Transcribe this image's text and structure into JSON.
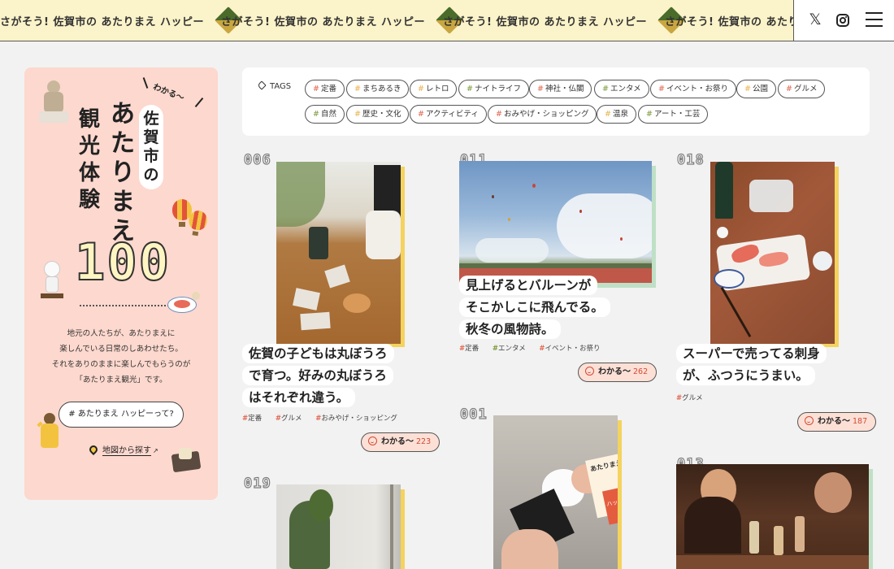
{
  "header": {
    "marquee_text": "さがそう! 佐賀市の あたりまえ ハッピー",
    "icons": [
      "x-icon",
      "instagram-icon",
      "menu-icon"
    ]
  },
  "sidebar": {
    "tagline": "わかる〜",
    "title_small": "佐賀市の",
    "title_main": "あたりまえ",
    "title_sub": "観光体験",
    "count": "100",
    "description": [
      "地元の人たちが、あたりまえに",
      "楽しんでいる日常のしあわせたち。",
      "それをありのままに楽しんでもらうのが",
      "「あたりまえ観光」です。"
    ],
    "happy_button": "# あたりまえ ハッピーって?",
    "map_link": "地図から探す",
    "map_link_arrow": "↗"
  },
  "tags": {
    "title": "TAGS",
    "items": [
      {
        "label": "定番",
        "hash_color": "#e0664f"
      },
      {
        "label": "まちあるき",
        "hash_color": "#e9b44c"
      },
      {
        "label": "レトロ",
        "hash_color": "#e9b44c"
      },
      {
        "label": "ナイトライフ",
        "hash_color": "#7a9a3a"
      },
      {
        "label": "神社・仏閣",
        "hash_color": "#e0664f"
      },
      {
        "label": "エンタメ",
        "hash_color": "#7a9a3a"
      },
      {
        "label": "イベント・お祭り",
        "hash_color": "#e0664f"
      },
      {
        "label": "公園",
        "hash_color": "#e9b44c"
      },
      {
        "label": "グルメ",
        "hash_color": "#e0664f"
      },
      {
        "label": "自然",
        "hash_color": "#7a9a3a"
      },
      {
        "label": "歴史・文化",
        "hash_color": "#e9b44c"
      },
      {
        "label": "アクティビティ",
        "hash_color": "#e0664f"
      },
      {
        "label": "おみやげ・ショッピング",
        "hash_color": "#e0664f"
      },
      {
        "label": "温泉",
        "hash_color": "#e9b44c"
      },
      {
        "label": "アート・工芸",
        "hash_color": "#7a9a3a"
      }
    ]
  },
  "cards": [
    {
      "number": "006",
      "caption": [
        "佐賀の子どもは丸ぼうろ",
        "で育つ。好みの丸ぼうろ",
        "はそれぞれ違う。"
      ],
      "tags": [
        "定番",
        "グルメ",
        "おみやげ・ショッピング"
      ],
      "wakaru_label": "わかる〜",
      "count": "223",
      "accent_color": "#f4d35e"
    },
    {
      "number": "011",
      "caption": [
        "見上げるとバルーンが",
        "そこかしこに飛んでる。",
        "秋冬の風物詩。"
      ],
      "tags": [
        "定番",
        "エンタメ",
        "イベント・お祭り"
      ],
      "wakaru_label": "わかる〜",
      "count": "262",
      "accent_color": "#bfe0c6"
    },
    {
      "number": "018",
      "caption": [
        "スーパーで売ってる刺身",
        "が、ふつうにうまい。"
      ],
      "tags": [
        "グルメ"
      ],
      "wakaru_label": "わかる〜",
      "count": "187",
      "accent_color": "#f4d35e"
    },
    {
      "number": "001",
      "accent_color": "#f4d35e",
      "photo_sign": {
        "line1": "あたりまえ",
        "line2": "ハッピー"
      }
    },
    {
      "number": "019",
      "accent_color": "#f4d35e"
    },
    {
      "number": "013",
      "accent_color": "#bfe0c6"
    }
  ]
}
